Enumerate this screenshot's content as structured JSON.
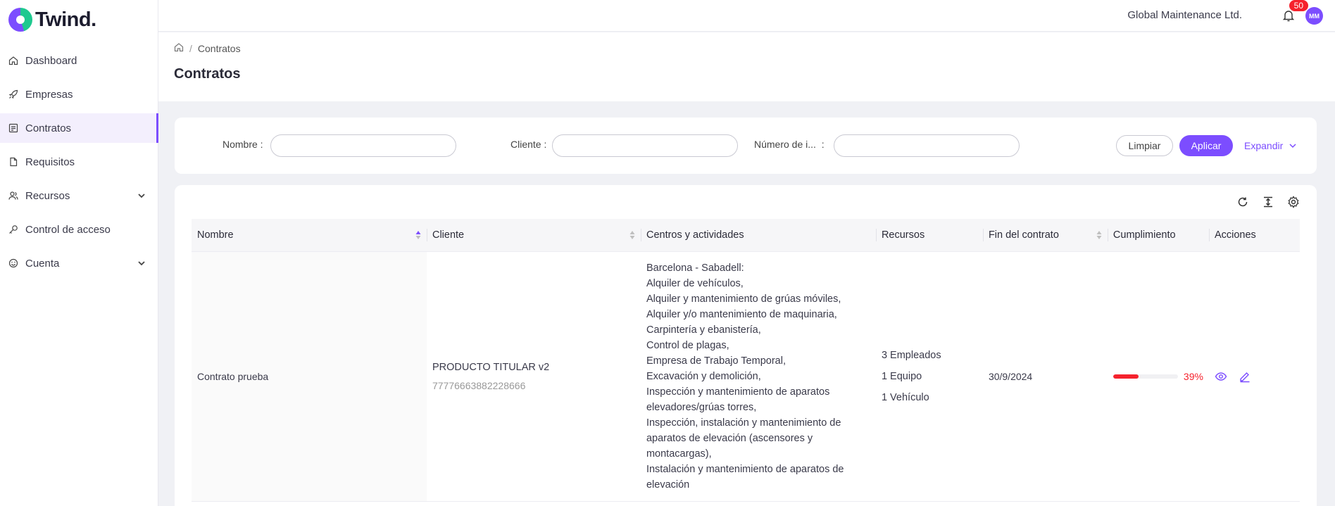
{
  "brand": {
    "name": "Twind."
  },
  "sidebar": {
    "items": [
      {
        "label": "Dashboard"
      },
      {
        "label": "Empresas"
      },
      {
        "label": "Contratos"
      },
      {
        "label": "Requisitos"
      },
      {
        "label": "Recursos"
      },
      {
        "label": "Control de acceso"
      },
      {
        "label": "Cuenta"
      }
    ]
  },
  "topbar": {
    "company": "Global Maintenance Ltd.",
    "notifications": "50",
    "avatar": "MM"
  },
  "breadcrumb": {
    "current": "Contratos"
  },
  "page": {
    "title": "Contratos"
  },
  "filters": {
    "nombre_label": "Nombre",
    "cliente_label": "Cliente",
    "numero_label": "Número de i...",
    "clear": "Limpiar",
    "apply": "Aplicar",
    "expand": "Expandir"
  },
  "table": {
    "columns": [
      "Nombre",
      "Cliente",
      "Centros y actividades",
      "Recursos",
      "Fin del contrato",
      "Cumplimiento",
      "Acciones"
    ],
    "rows": [
      {
        "nombre": "Contrato prueba",
        "cliente": "PRODUCTO TITULAR v2",
        "cliente_id": "77776663882228666",
        "centros": [
          "Barcelona - Sabadell:",
          "Alquiler de vehículos,",
          "Alquiler y mantenimiento de grúas móviles,",
          "Alquiler y/o mantenimiento de maquinaria,",
          "Carpintería y ebanistería,",
          "Control de plagas,",
          "Empresa de Trabajo Temporal,",
          "Excavación y demolición,",
          "Inspección y mantenimiento de aparatos",
          "elevadores/grúas torres,",
          "Inspección, instalación y mantenimiento de",
          "aparatos de elevación (ascensores y",
          "montacargas),",
          "Instalación y mantenimiento de aparatos de",
          "elevación"
        ],
        "recursos": [
          "3 Empleados",
          "1 Equipo",
          "1 Vehículo"
        ],
        "fin": "30/9/2024",
        "cumplimiento_pct": 39,
        "cumplimiento_label": "39%"
      }
    ]
  },
  "colors": {
    "accent": "#7c4dff",
    "danger": "#f5222d",
    "brand_green": "#1ec98f"
  }
}
